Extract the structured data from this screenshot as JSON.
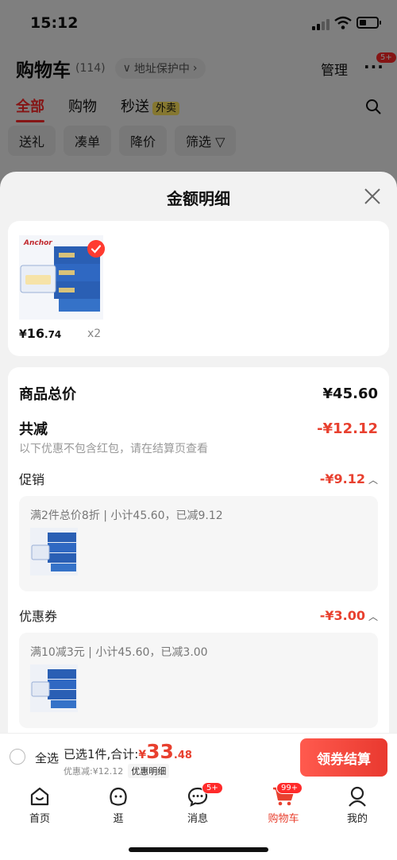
{
  "status": {
    "time": "15:12"
  },
  "header": {
    "title": "购物车",
    "count": "(114)",
    "address": "地址保护中",
    "manage": "管理",
    "more_badge": "5+"
  },
  "tabs": [
    "全部",
    "购物",
    "秒送"
  ],
  "takeout_tag": "外卖",
  "filters": [
    "送礼",
    "凑单",
    "降价",
    "筛选"
  ],
  "sheet": {
    "title": "金额明细",
    "item": {
      "yen": "¥",
      "price_int": "16",
      "price_dec": ".74",
      "qty": "x2",
      "brand": "Anchor"
    },
    "total_label": "商品总价",
    "total_value": "¥45.60",
    "reduce_label": "共减",
    "reduce_value": "-¥12.12",
    "note": "以下优惠不包含红包，请在结算页查看",
    "promo_label": "促销",
    "promo_value": "-¥9.12",
    "promo_detail": "满2件总价8折 | 小计45.60，已减9.12",
    "coupon_label": "优惠券",
    "coupon_value": "-¥3.00",
    "coupon_detail": "满10减3元 | 小计45.60，已减3.00"
  },
  "checkout": {
    "select_all": "全选",
    "sum_label": "已选1件,合计:",
    "yen": "¥",
    "sum_int": "33",
    "sum_dec": ".48",
    "discount": "优惠减:¥12.12",
    "detail_link": "优惠明细",
    "pay": "领券结算"
  },
  "tabbar": [
    {
      "label": "首页"
    },
    {
      "label": "逛"
    },
    {
      "label": "消息",
      "badge": "5+"
    },
    {
      "label": "购物车",
      "badge": "99+"
    },
    {
      "label": "我的"
    }
  ],
  "colors": {
    "accent": "#e8402f",
    "tab_active": "#ff2a2a",
    "takeout": "#ffe45c"
  }
}
